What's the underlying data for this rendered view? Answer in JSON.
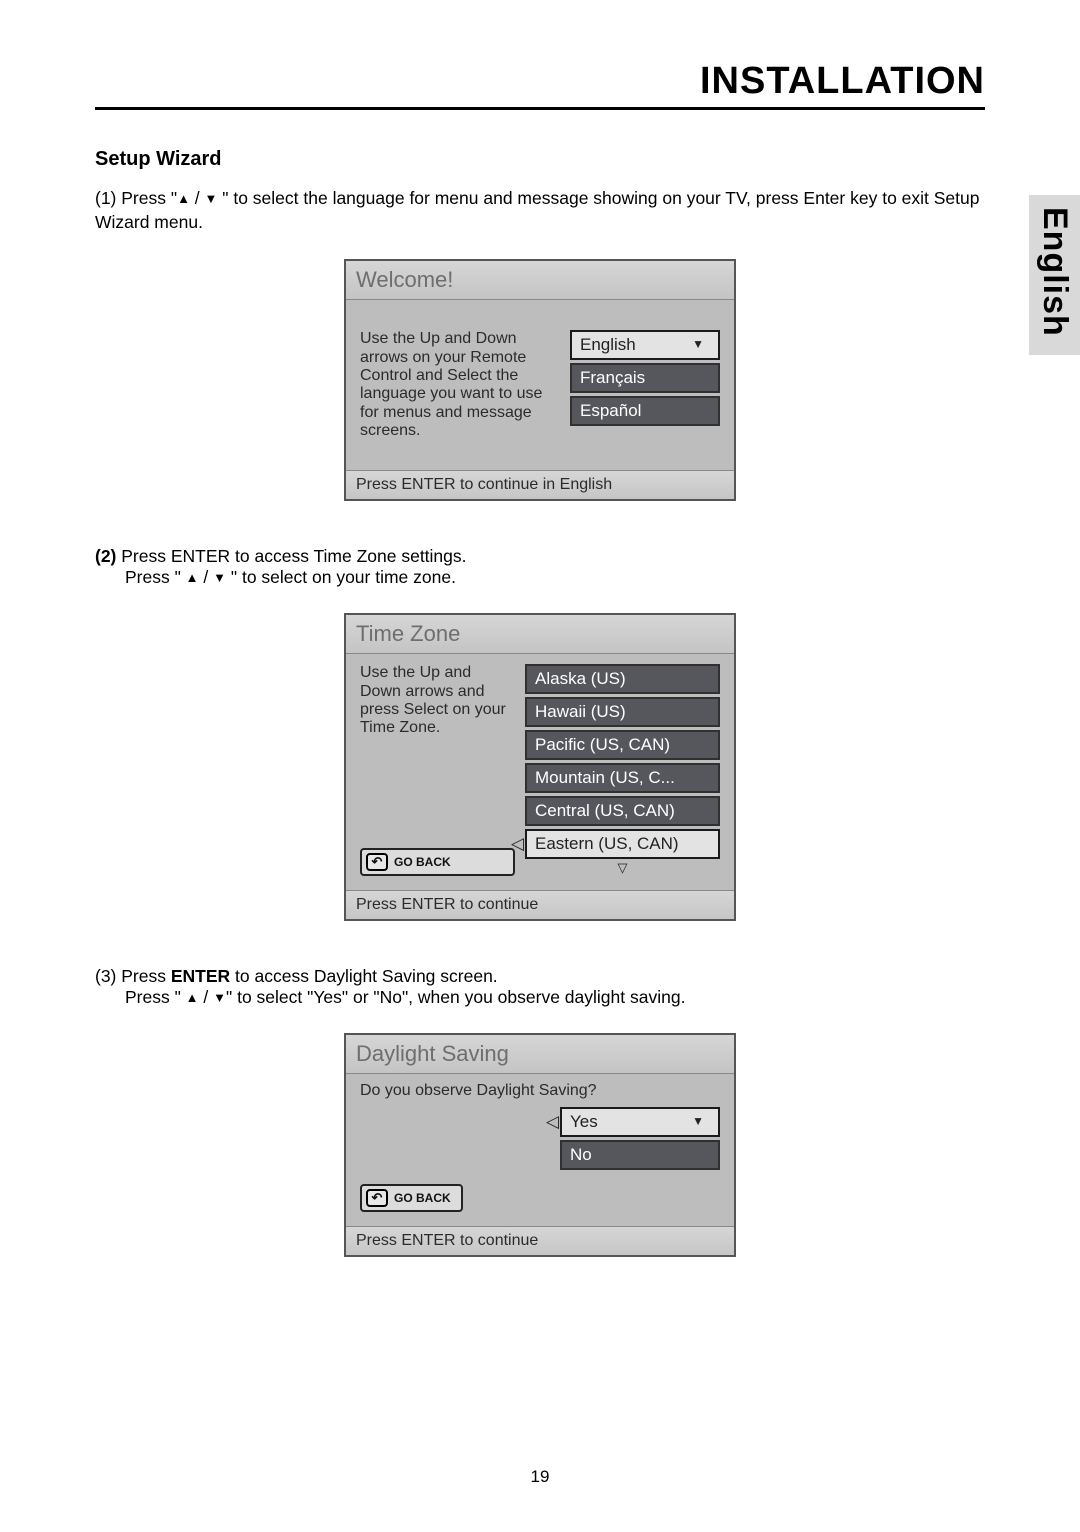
{
  "page": {
    "section_header": "INSTALLATION",
    "side_tab": "English",
    "page_number": "19"
  },
  "setup": {
    "heading": "Setup Wizard",
    "step1_prefix": "(1) Press \"",
    "step1_mid": " / ",
    "step1_suffix": " \" to select the language for menu and message showing on your TV, press Enter key to exit Setup Wizard menu.",
    "step2_prefix": "(2)",
    "step2_line1": " Press ENTER to access Time Zone settings.",
    "step2_line2a": "Press \" ",
    "step2_line2b": " / ",
    "step2_line2c": " \" to select on your time zone.",
    "step3_line1a": "(3) Press ",
    "step3_line1b": "ENTER",
    "step3_line1c": " to access Daylight Saving screen.",
    "step3_line2a": "Press \" ",
    "step3_line2b": " / ",
    "step3_line2c": "\" to select \"Yes\" or \"No\", when you observe daylight saving."
  },
  "osd_welcome": {
    "title": "Welcome!",
    "descr": "Use the Up and Down arrows on your Remote Control and Select the language you want to use for menus and message screens.",
    "options": [
      "English",
      "Français",
      "Español"
    ],
    "footer": "Press ENTER to continue in English"
  },
  "osd_timezone": {
    "title": "Time Zone",
    "descr": "Use the Up and Down arrows and press Select on your Time Zone.",
    "options": [
      "Alaska (US)",
      "Hawaii (US)",
      "Pacific (US, CAN)",
      "Mountain (US, C...",
      "Central (US, CAN)",
      "Eastern (US, CAN)"
    ],
    "goback": "GO BACK",
    "footer": "Press ENTER to continue"
  },
  "osd_daylight": {
    "title": "Daylight Saving",
    "descr": "Do you observe Daylight Saving?",
    "options": [
      "Yes",
      "No"
    ],
    "goback": "GO BACK",
    "footer": "Press ENTER to continue"
  }
}
